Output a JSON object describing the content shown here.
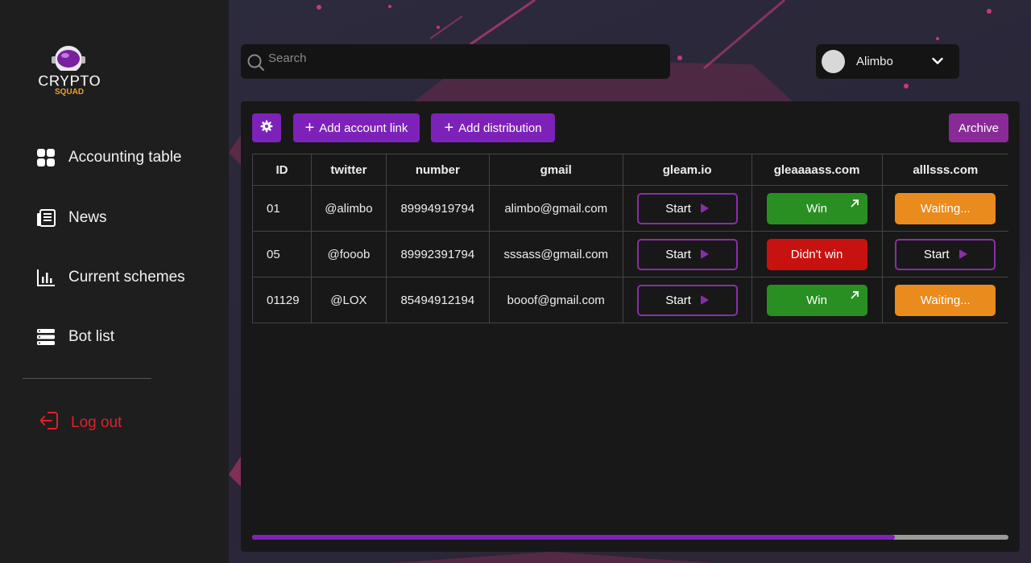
{
  "brand": {
    "logo_top": "CRYPTO",
    "logo_bottom": "SQUAD"
  },
  "sidebar": {
    "items": [
      {
        "label": "Accounting table",
        "icon": "grid-icon"
      },
      {
        "label": "News",
        "icon": "news-icon"
      },
      {
        "label": "Current schemes",
        "icon": "bar-chart-icon"
      },
      {
        "label": "Bot list",
        "icon": "list-icon"
      }
    ],
    "logout_label": "Log out"
  },
  "search": {
    "placeholder": "Search"
  },
  "user": {
    "name": "Alimbo"
  },
  "toolbar": {
    "add_account_link": "Add account link",
    "add_distribution": "Add distribution",
    "archive": "Archive"
  },
  "table": {
    "headers": [
      "ID",
      "twitter",
      "number",
      "gmail",
      "gleam.io",
      "gleaaaass.com",
      "alllsss.com"
    ],
    "rows": [
      {
        "id": "01",
        "twitter": "@alimbo",
        "number": "89994919794",
        "gmail": "alimbo@gmail.com",
        "gleam": "Start",
        "gleaaaass": "Win",
        "alllsss": "Waiting..."
      },
      {
        "id": "05",
        "twitter": "@fooob",
        "number": "89992391794",
        "gmail": "sssass@gmail.com",
        "gleam": "Start",
        "gleaaaass": "Didn't win",
        "alllsss": "Start"
      },
      {
        "id": "01129",
        "twitter": "@LOX",
        "number": "85494912194",
        "gmail": "booof@gmail.com",
        "gleam": "Start",
        "gleaaaass": "Win",
        "alllsss": "Waiting..."
      }
    ]
  },
  "scroll": {
    "position_fraction": 0.85
  },
  "colors": {
    "accent": "#7d22b8",
    "win": "#2a8f22",
    "lose": "#c8120f",
    "waiting": "#ea8b1d",
    "logout": "#e0202a"
  }
}
